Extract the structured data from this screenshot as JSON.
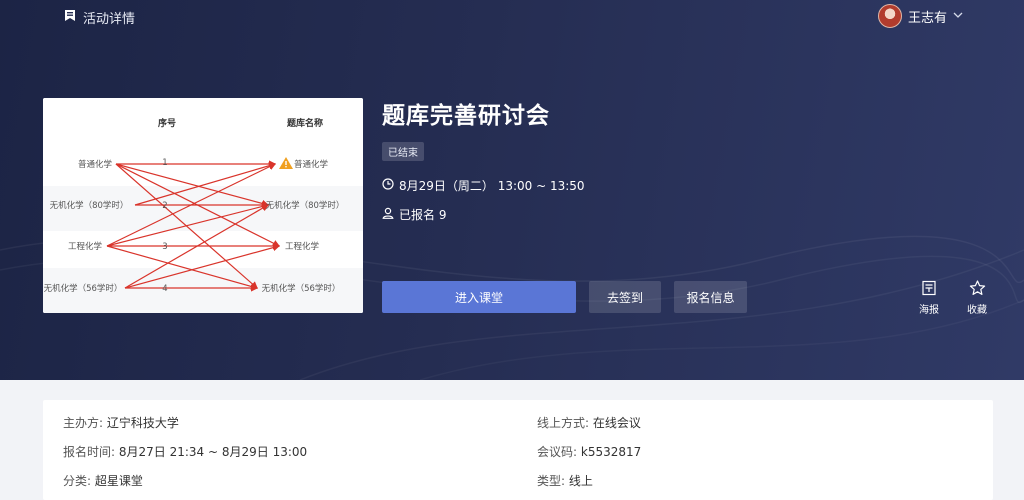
{
  "topbar": {
    "page_title": "活动详情",
    "page_icon": "bookmark-icon"
  },
  "user": {
    "name": "王志有"
  },
  "activity": {
    "title": "题库完善研讨会",
    "status": "已结束",
    "time": "8月29日（周二） 13:00 ~ 13:50",
    "signup_count": "已报名 9"
  },
  "cover": {
    "headers": {
      "index": "序号",
      "name": "题库名称"
    },
    "left_items": [
      "普通化学",
      "无机化学（80学时）",
      "工程化学",
      "无机化学（56学时）"
    ],
    "indices": [
      "1",
      "2",
      "3",
      "4"
    ],
    "right_items": [
      "普通化学",
      "无机化学（80学时）",
      "工程化学",
      "无机化学（56学时）"
    ],
    "colors": {
      "arrow": "#d9342b",
      "warning": "#f0a020"
    }
  },
  "actions": {
    "enter": "进入课堂",
    "sign_in": "去签到",
    "signup_info": "报名信息",
    "poster": "海报",
    "favorite": "收藏"
  },
  "details": {
    "organizer_label": "主办方:",
    "organizer": "辽宁科技大学",
    "signup_time_label": "报名时间:",
    "signup_time": "8月27日 21:34 ~ 8月29日 13:00",
    "category_label": "分类:",
    "category": "超星课堂",
    "online_label": "线上方式:",
    "online": "在线会议",
    "code_label": "会议码:",
    "code": "k5532817",
    "type_label": "类型:",
    "type": "线上"
  },
  "colors": {
    "primary": "#5a76d6",
    "hero_bg": "#252d52"
  }
}
